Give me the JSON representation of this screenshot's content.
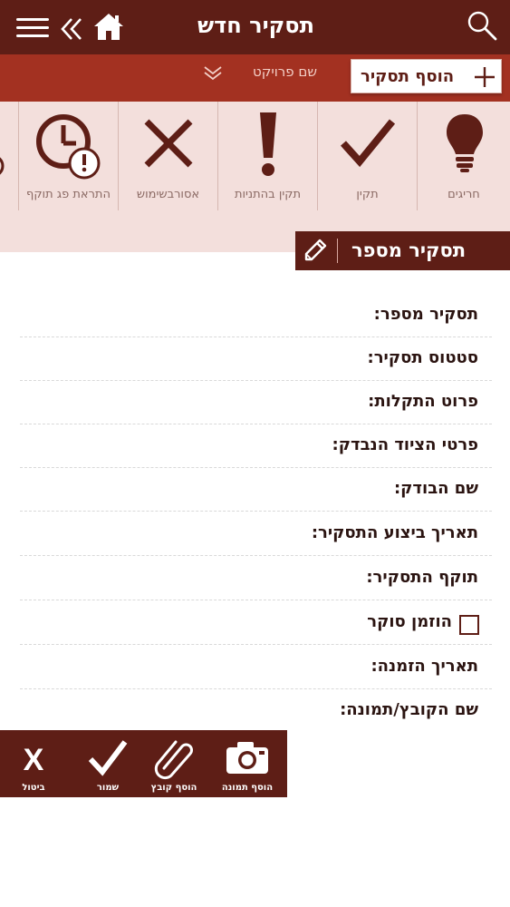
{
  "header": {
    "title": "תסקיר חדש",
    "icons": [
      "menu-icon",
      "double-chevron-left-icon",
      "home-icon",
      "search-icon"
    ]
  },
  "project": {
    "label": "שם פרויקט",
    "add_report_label": "הוסף תסקיר"
  },
  "categories": [
    {
      "label": "חריגים",
      "icon": "lightbulb-icon"
    },
    {
      "label": "תקין",
      "icon": "checkmark-icon"
    },
    {
      "label": "תקין בהתניות",
      "icon": "exclamation-icon"
    },
    {
      "label": "אסורבשימוש",
      "icon": "x-mark-icon"
    },
    {
      "label": "התראת פג תוקף",
      "icon": "clock-alert-icon"
    }
  ],
  "section": {
    "title": "תסקיר מספר"
  },
  "form": {
    "fields": [
      "תסקיר מספר:",
      "סטטוס תסקיר:",
      "פרוט התקלות:",
      "פרטי הציוד הנבדק:",
      "שם הבודק:",
      "תאריך ביצוע התסקיר:",
      "תוקף התסקיר:"
    ],
    "checkbox_label": "הוזמן סוקר",
    "fields2": [
      "תאריך הזמנה:",
      "שם הקובץ/תמונה:"
    ]
  },
  "actions": {
    "add_photo": "הוסף תמונה",
    "add_file": "הוסף קובץ",
    "save": "שמור",
    "cancel_glyph": "X",
    "cancel": "ביטול"
  },
  "colors": {
    "header": "#5e1e16",
    "project_bar": "#a33121",
    "strip_bg": "#f3dfdc",
    "icon": "#5e1e16"
  }
}
